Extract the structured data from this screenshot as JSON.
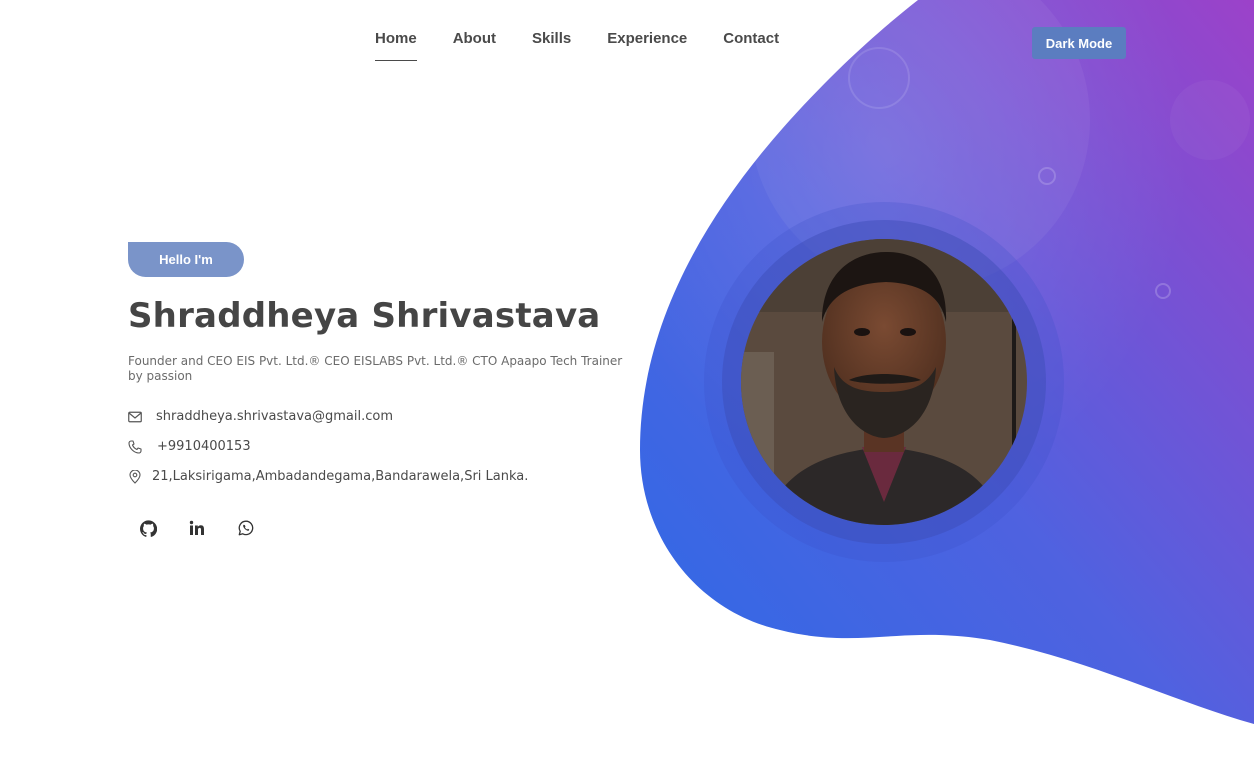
{
  "nav": {
    "items": [
      {
        "label": "Home",
        "active": true
      },
      {
        "label": "About",
        "active": false
      },
      {
        "label": "Skills",
        "active": false
      },
      {
        "label": "Experience",
        "active": false
      },
      {
        "label": "Contact",
        "active": false
      }
    ],
    "dark_mode_label": "Dark Mode"
  },
  "hero": {
    "greeting": "Hello I'm",
    "name": "Shraddheya Shrivastava",
    "tagline": "Founder and CEO EIS Pvt. Ltd.® CEO EISLABS Pvt. Ltd.® CTO Apaapo Tech Trainer by passion",
    "email": "shraddheya.shrivastava@gmail.com",
    "phone": "+9910400153",
    "address": "21,Laksirigama,Ambadandegama,Bandarawela,Sri Lanka."
  },
  "socials": [
    {
      "icon": "github-icon"
    },
    {
      "icon": "linkedin-icon"
    },
    {
      "icon": "whatsapp-icon"
    }
  ],
  "colors": {
    "accent": "#5b7dc0",
    "badge": "#7a94c9",
    "blob_start": "#2f6be8",
    "blob_end": "#9c44c8",
    "text_dark": "#454545"
  }
}
